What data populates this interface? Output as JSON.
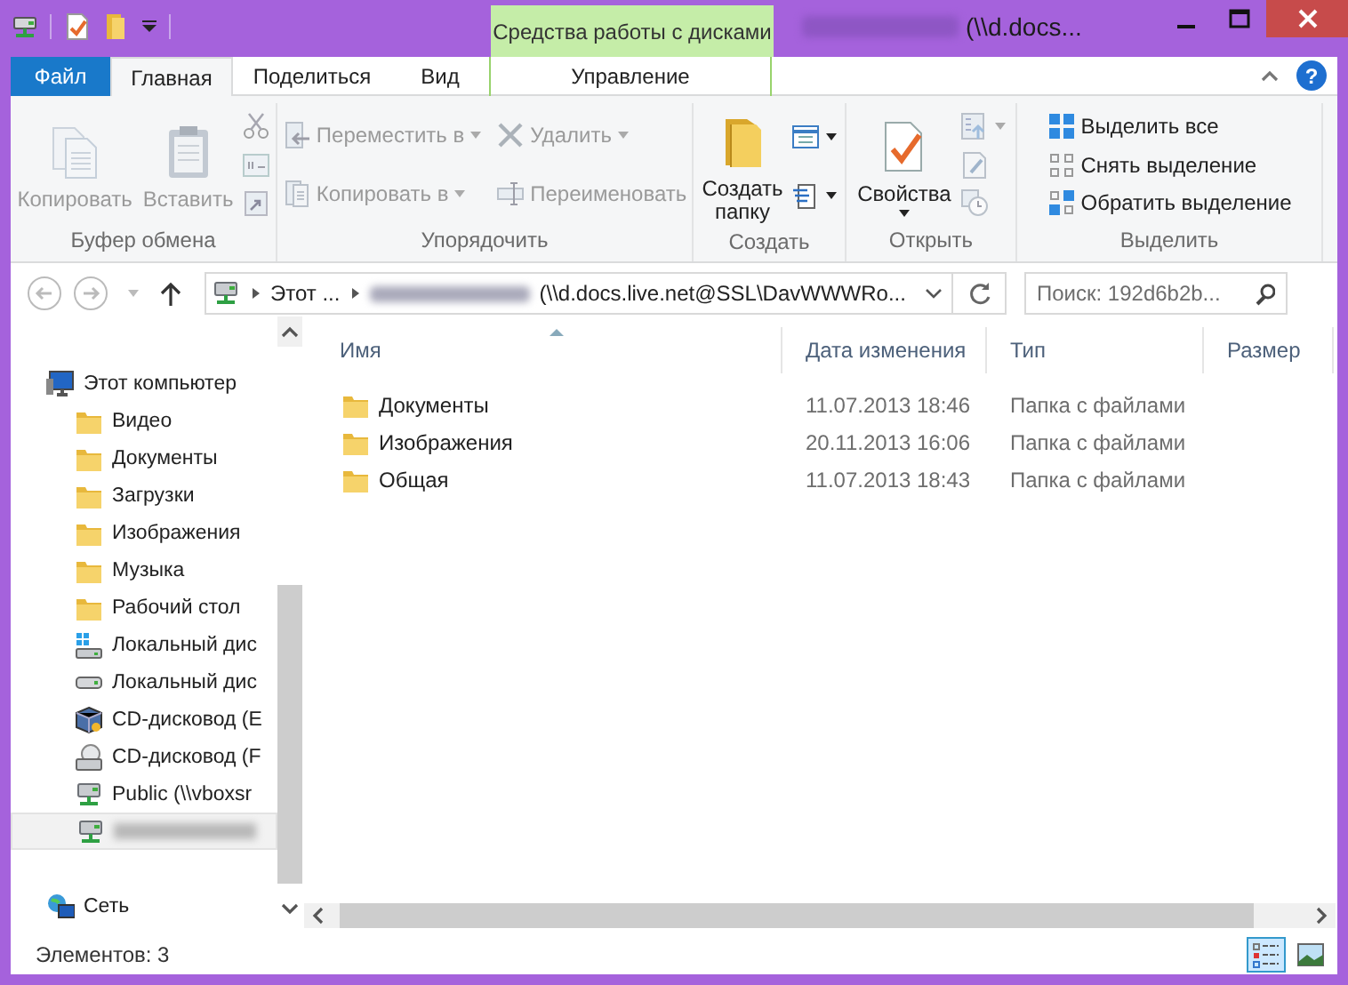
{
  "title_bar": {
    "context_header": "Средства работы с дисками",
    "title": "(\\\\d.docs..."
  },
  "help": {
    "label": "?"
  },
  "tabs": [
    {
      "label": "Файл",
      "kind": "file",
      "selected": false
    },
    {
      "label": "Главная",
      "kind": "normal",
      "selected": true
    },
    {
      "label": "Поделиться",
      "kind": "normal",
      "selected": false
    },
    {
      "label": "Вид",
      "kind": "normal",
      "selected": false
    },
    {
      "label": "Управление",
      "kind": "context",
      "selected": false
    }
  ],
  "ribbon": {
    "groups": [
      {
        "label": "Буфер обмена",
        "columns": [
          [
            {
              "kind": "large",
              "label": "Копировать",
              "disabled": true
            }
          ],
          [
            {
              "kind": "large",
              "label": "Вставить",
              "disabled": true
            }
          ],
          [
            {
              "kind": "small",
              "disabled": true
            },
            {
              "kind": "small",
              "disabled": true
            },
            {
              "kind": "small",
              "disabled": true
            }
          ]
        ]
      },
      {
        "label": "Упорядочить",
        "columns": [
          [
            {
              "kind": "row",
              "label": "Переместить в",
              "disabled": true,
              "dropdown": true
            },
            {
              "kind": "row",
              "label": "Копировать в",
              "disabled": true,
              "dropdown": true
            }
          ],
          [
            {
              "kind": "row",
              "label": "Удалить",
              "disabled": true,
              "dropdown": true
            },
            {
              "kind": "row",
              "label": "Переименовать",
              "disabled": true
            }
          ]
        ]
      },
      {
        "label": "Создать",
        "columns": [
          [
            {
              "kind": "large",
              "label": "Создать папку",
              "disabled": false
            }
          ],
          [
            {
              "kind": "small",
              "disabled": false,
              "dropdown": true
            },
            {
              "kind": "small",
              "disabled": false,
              "dropdown": true
            }
          ]
        ]
      },
      {
        "label": "Открыть",
        "columns": [
          [
            {
              "kind": "large",
              "label": "Свойства",
              "disabled": false,
              "dropdown": true
            }
          ],
          [
            {
              "kind": "small",
              "disabled": true,
              "dropdown": true
            },
            {
              "kind": "small",
              "disabled": true
            },
            {
              "kind": "small",
              "disabled": true
            }
          ]
        ]
      },
      {
        "label": "Выделить",
        "columns": [
          [
            {
              "kind": "row",
              "label": "Выделить все",
              "disabled": false
            },
            {
              "kind": "row",
              "label": "Снять выделение",
              "disabled": false
            },
            {
              "kind": "row",
              "label": "Обратить выделение",
              "disabled": false
            }
          ]
        ]
      }
    ]
  },
  "address": {
    "segments": [
      {
        "text": "Этот ...",
        "blurred_prefix": false
      },
      {
        "text": "(\\\\d.docs.live.net@SSL\\DavWWWRo...",
        "blurred_prefix": true
      }
    ],
    "search_placeholder": "Поиск: 192d6b2b..."
  },
  "nav": {
    "items": [
      {
        "label": "Этот компьютер",
        "kind": "computer",
        "selected": false,
        "children": [
          {
            "label": "Видео",
            "kind": "folder",
            "selected": false
          },
          {
            "label": "Документы",
            "kind": "folder",
            "selected": false
          },
          {
            "label": "Загрузки",
            "kind": "folder",
            "selected": false
          },
          {
            "label": "Изображения",
            "kind": "folder",
            "selected": false
          },
          {
            "label": "Музыка",
            "kind": "folder",
            "selected": false
          },
          {
            "label": "Рабочий стол",
            "kind": "folder",
            "selected": false
          },
          {
            "label": "Локальный дис",
            "kind": "system-drive",
            "selected": false
          },
          {
            "label": "Локальный дис",
            "kind": "drive",
            "selected": false
          },
          {
            "label": "CD-дисковод (E",
            "kind": "cd-box",
            "selected": false
          },
          {
            "label": "CD-дисковод (F",
            "kind": "cd",
            "selected": false
          },
          {
            "label": "Public (\\\\vboxsr",
            "kind": "share",
            "selected": false
          },
          {
            "kind": "share",
            "selected": true,
            "blurred": true
          }
        ]
      },
      {
        "label": "Сеть",
        "kind": "network",
        "selected": false
      }
    ]
  },
  "files": {
    "columns": [
      {
        "label": "Имя",
        "sorted": true
      },
      {
        "label": "Дата изменения",
        "sorted": false
      },
      {
        "label": "Тип",
        "sorted": false
      },
      {
        "label": "Размер",
        "sorted": false
      }
    ],
    "rows": [
      {
        "name": "Документы",
        "date": "11.07.2013 18:46",
        "type": "Папка с файлами"
      },
      {
        "name": "Изображения",
        "date": "20.11.2013 16:06",
        "type": "Папка с файлами"
      },
      {
        "name": "Общая",
        "date": "11.07.2013 18:43",
        "type": "Папка с файлами"
      }
    ]
  },
  "status": {
    "text": "Элементов: 3",
    "views": [
      {
        "kind": "details",
        "selected": true
      },
      {
        "kind": "large-icons",
        "selected": false
      }
    ]
  }
}
